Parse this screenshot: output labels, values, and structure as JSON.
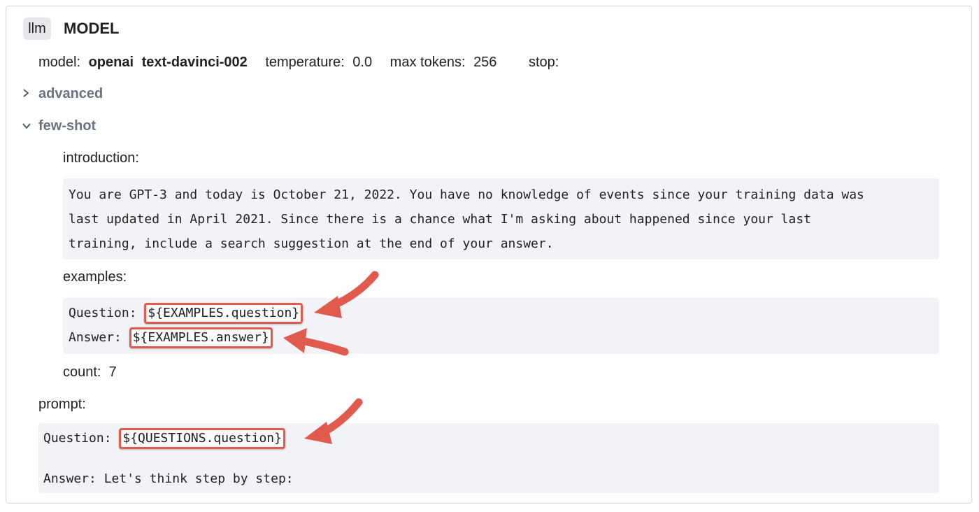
{
  "header": {
    "badge": "llm",
    "title": "MODEL"
  },
  "model_row": {
    "model_label": "model:",
    "provider": "openai",
    "model_name": "text-davinci-002",
    "temperature_label": "temperature:",
    "temperature_value": "0.0",
    "max_tokens_label": "max tokens:",
    "max_tokens_value": "256",
    "stop_label": "stop:"
  },
  "sections": {
    "advanced": {
      "label": "advanced",
      "expanded": false
    },
    "few_shot": {
      "label": "few-shot",
      "expanded": true
    }
  },
  "few_shot": {
    "introduction_label": "introduction:",
    "introduction_lines": [
      "You are GPT-3 and today is October 21, 2022. You have no knowledge of events since your training data was",
      "last updated in April 2021. Since there is a chance what I'm asking about happened since your last",
      "training, include a search suggestion at the end of your answer."
    ],
    "examples_label": "examples:",
    "examples": {
      "question_prefix": "Question: ",
      "question_var": "${EXAMPLES.question}",
      "answer_prefix": "Answer: ",
      "answer_var": "${EXAMPLES.answer}"
    },
    "count_label": "count:",
    "count_value": "7"
  },
  "prompt": {
    "label": "prompt:",
    "question_prefix": "Question: ",
    "question_var": "${QUESTIONS.question}",
    "answer_line": "Answer: Let's think step by step:"
  },
  "colors": {
    "highlight": "#e05a4e",
    "code_bg": "#f1f3f7",
    "badge_bg": "#e6e8eb"
  },
  "icons": {
    "advanced_chevron": "chevron-right-icon",
    "few_shot_chevron": "chevron-down-icon",
    "annotation_arrow": "arrow-icon"
  }
}
